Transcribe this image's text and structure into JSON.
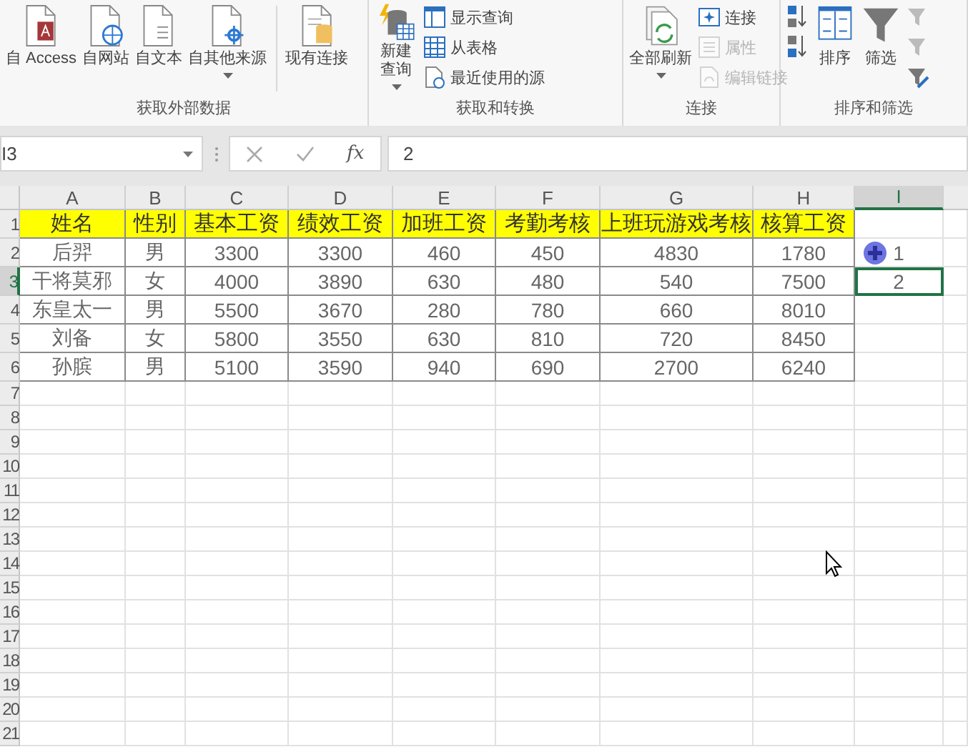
{
  "ribbon": {
    "groups": [
      {
        "label": "获取外部数据",
        "buttons": [
          {
            "label": "自 Access",
            "kind": "large",
            "caret": false
          },
          {
            "label": "自网站",
            "kind": "large",
            "caret": false
          },
          {
            "label": "自文本",
            "kind": "large",
            "caret": false
          },
          {
            "label": "自其他来源",
            "kind": "large",
            "caret": true
          },
          {
            "label": "现有连接",
            "kind": "large",
            "caret": false
          }
        ]
      },
      {
        "label": "获取和转换",
        "buttons": [
          {
            "label": "新建查询",
            "kind": "large",
            "caret": true
          },
          {
            "label": "显示查询",
            "kind": "small",
            "disabled": false
          },
          {
            "label": "从表格",
            "kind": "small",
            "disabled": false
          },
          {
            "label": "最近使用的源",
            "kind": "small",
            "disabled": false
          }
        ]
      },
      {
        "label": "连接",
        "buttons": [
          {
            "label": "全部刷新",
            "kind": "large",
            "caret": true
          },
          {
            "label": "连接",
            "kind": "small",
            "disabled": false
          },
          {
            "label": "属性",
            "kind": "small",
            "disabled": true
          },
          {
            "label": "编辑链接",
            "kind": "small",
            "disabled": true
          }
        ]
      },
      {
        "label": "排序和筛选",
        "buttons": [
          {
            "kind": "icon"
          },
          {
            "kind": "icon"
          },
          {
            "label": "排序",
            "kind": "large",
            "caret": false
          },
          {
            "label": "筛选",
            "kind": "large",
            "caret": false
          },
          {
            "kind": "icon"
          },
          {
            "kind": "icon"
          },
          {
            "kind": "icon"
          }
        ]
      }
    ]
  },
  "formula_bar": {
    "name_box": "I3",
    "function_label": "fx",
    "formula": "2"
  },
  "sheet": {
    "columns": [
      {
        "label": "A",
        "selected": false
      },
      {
        "label": "B",
        "selected": false
      },
      {
        "label": "C",
        "selected": false
      },
      {
        "label": "D",
        "selected": false
      },
      {
        "label": "E",
        "selected": false
      },
      {
        "label": "F",
        "selected": false
      },
      {
        "label": "G",
        "selected": false
      },
      {
        "label": "H",
        "selected": false
      },
      {
        "label": "I",
        "selected": true
      }
    ],
    "rows": [
      {
        "number": "1",
        "selected": false,
        "kind": "header",
        "cells": [
          "姓名",
          "性别",
          "基本工资",
          "绩效工资",
          "加班工资",
          "考勤考核",
          "上班玩游戏考核",
          "核算工资"
        ]
      },
      {
        "number": "2",
        "selected": false,
        "kind": "data",
        "marker": true,
        "cells": [
          "后羿",
          "男",
          "3300",
          "3300",
          "460",
          "450",
          "4830",
          "1780",
          "1"
        ]
      },
      {
        "number": "3",
        "selected": true,
        "kind": "data",
        "marker": false,
        "cells": [
          "干将莫邪",
          "女",
          "4000",
          "3890",
          "630",
          "480",
          "540",
          "7500",
          "2"
        ]
      },
      {
        "number": "4",
        "selected": false,
        "kind": "data",
        "cells": [
          "东皇太一",
          "男",
          "5500",
          "3670",
          "280",
          "780",
          "660",
          "8010"
        ]
      },
      {
        "number": "5",
        "selected": false,
        "kind": "data",
        "cells": [
          "刘备",
          "女",
          "5800",
          "3550",
          "630",
          "810",
          "720",
          "8450"
        ]
      },
      {
        "number": "6",
        "selected": false,
        "kind": "data",
        "cells": [
          "孙膑",
          "男",
          "5100",
          "3590",
          "940",
          "690",
          "2700",
          "6240"
        ]
      },
      {
        "number": "7",
        "selected": false
      },
      {
        "number": "8",
        "selected": false
      },
      {
        "number": "9",
        "selected": false
      },
      {
        "number": "10",
        "selected": false
      },
      {
        "number": "11",
        "selected": false
      },
      {
        "number": "12",
        "selected": false
      },
      {
        "number": "13",
        "selected": false
      },
      {
        "number": "14",
        "selected": false
      },
      {
        "number": "15",
        "selected": false
      },
      {
        "number": "16",
        "selected": false
      },
      {
        "number": "17",
        "selected": false
      },
      {
        "number": "18",
        "selected": false
      },
      {
        "number": "19",
        "selected": false
      },
      {
        "number": "20",
        "selected": false
      },
      {
        "number": "21",
        "selected": false
      }
    ]
  }
}
